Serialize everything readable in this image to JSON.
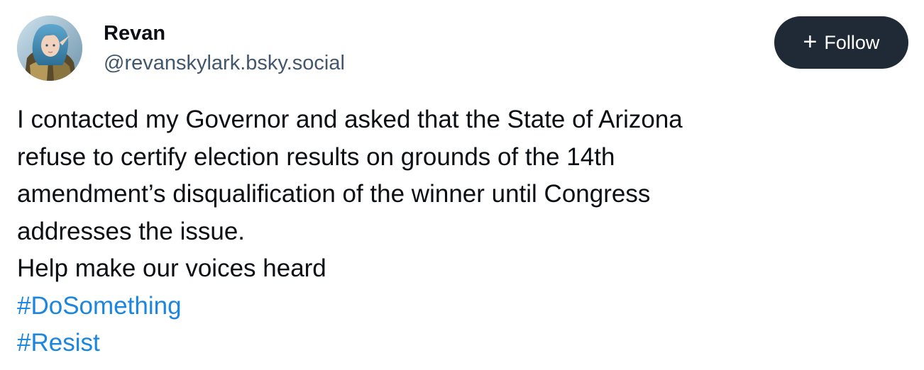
{
  "post": {
    "author": {
      "display_name": "Revan",
      "handle": "@revanskylark.bsky.social",
      "avatar_icon": "avatar-illustration-icon"
    },
    "follow_button": {
      "icon": "plus-icon",
      "label": "Follow",
      "background_color": "#1f2a36",
      "text_color": "#ffffff"
    },
    "text_lines": [
      "I contacted my Governor and asked that the State of Arizona",
      "refuse to certify election results on grounds of the 14th",
      "amendment’s disqualification of the winner until Congress",
      "addresses the issue.",
      "Help make our voices heard"
    ],
    "hashtags": [
      "#DoSomething",
      "#Resist"
    ],
    "hashtag_color": "#1a86e0"
  }
}
